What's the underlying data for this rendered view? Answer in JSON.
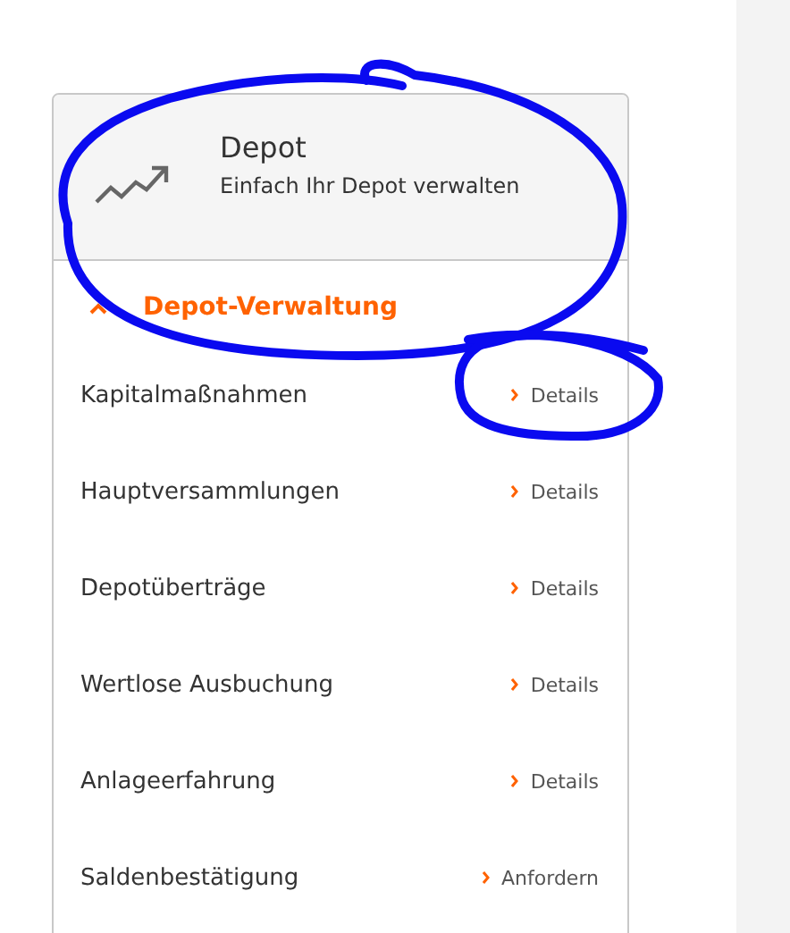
{
  "card": {
    "title": "Depot",
    "subtitle": "Einfach Ihr Depot verwalten"
  },
  "section": {
    "title": "Depot-Verwaltung",
    "expanded": true
  },
  "items": [
    {
      "label": "Kapitalmaßnahmen",
      "action": "Details"
    },
    {
      "label": "Hauptversammlungen",
      "action": "Details"
    },
    {
      "label": "Depotüberträge",
      "action": "Details"
    },
    {
      "label": "Wertlose Ausbuchung",
      "action": "Details"
    },
    {
      "label": "Anlageerfahrung",
      "action": "Details"
    },
    {
      "label": "Saldenbestätigung",
      "action": "Anfordern"
    }
  ],
  "markup": [
    {
      "kind": "circle"
    },
    {
      "kind": "circle"
    }
  ]
}
